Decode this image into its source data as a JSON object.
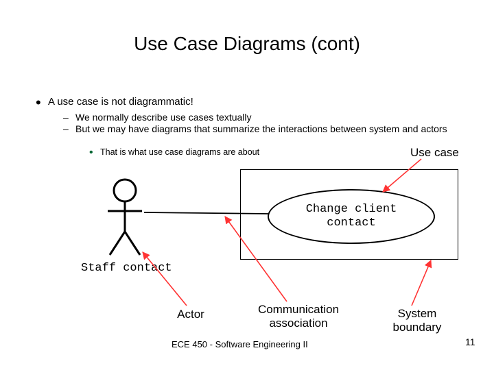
{
  "title": "Use Case Diagrams (cont)",
  "bullets": {
    "b1": "A use case is not diagrammatic!",
    "b2a": "We normally describe use cases textually",
    "b2b": "But we may have diagrams that summarize the interactions between system and actors",
    "b3": "That is what use case diagrams are about"
  },
  "labels": {
    "usecase": "Use case",
    "staff": "Staff contact",
    "ellipse_text": "Change client\ncontact",
    "actor": "Actor",
    "comm": "Communication\nassociation",
    "boundary": "System\nboundary"
  },
  "footer": "ECE 450 - Software Engineering II",
  "page": "11"
}
